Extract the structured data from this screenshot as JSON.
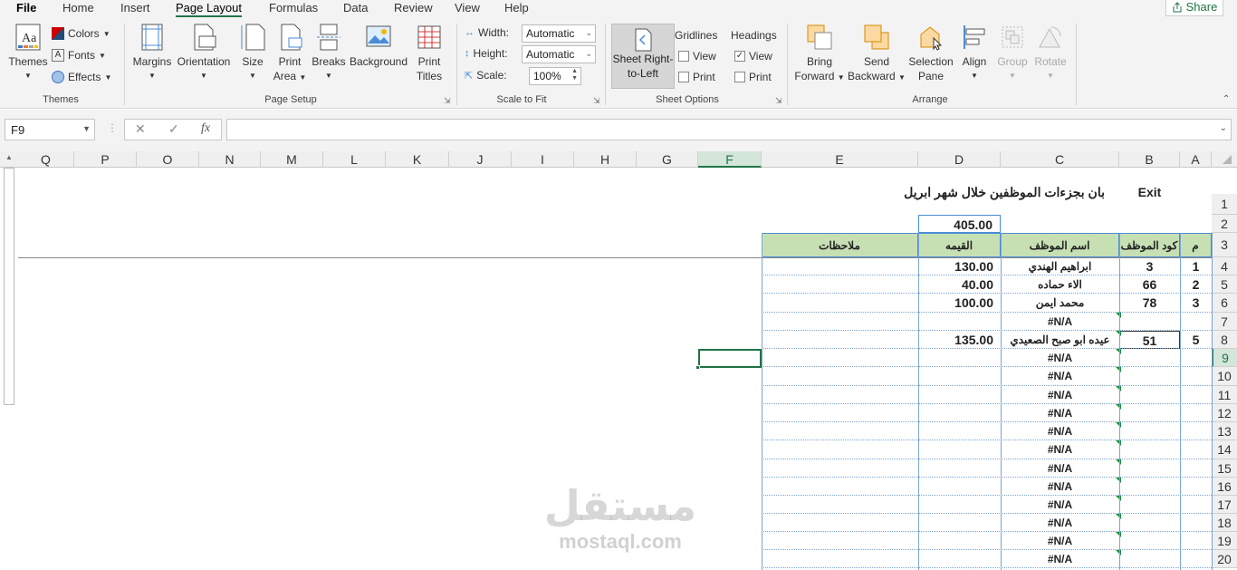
{
  "tabs": {
    "file": "File",
    "home": "Home",
    "insert": "Insert",
    "page_layout": "Page Layout",
    "formulas": "Formulas",
    "data": "Data",
    "review": "Review",
    "view": "View",
    "help": "Help",
    "share": "Share"
  },
  "ribbon": {
    "themes": {
      "themes": "Themes",
      "colors": "Colors",
      "fonts": "Fonts",
      "effects": "Effects",
      "group": "Themes"
    },
    "page_setup": {
      "margins": "Margins",
      "orientation": "Orientation",
      "size": "Size",
      "print_area_1": "Print",
      "print_area_2": "Area",
      "breaks": "Breaks",
      "background": "Background",
      "print_titles_1": "Print",
      "print_titles_2": "Titles",
      "group": "Page Setup"
    },
    "scale": {
      "width_label": "Width:",
      "width_value": "Automatic",
      "height_label": "Height:",
      "height_value": "Automatic",
      "scale_label": "Scale:",
      "scale_value": "100%",
      "group": "Scale to Fit"
    },
    "sheet_options": {
      "rtl_1": "Sheet Right-",
      "rtl_2": "to-Left",
      "gridlines": "Gridlines",
      "headings": "Headings",
      "view": "View",
      "print": "Print",
      "group": "Sheet Options"
    },
    "arrange": {
      "bring_1": "Bring",
      "bring_2": "Forward",
      "send_1": "Send",
      "send_2": "Backward",
      "sel_1": "Selection",
      "sel_2": "Pane",
      "align": "Align",
      "group_btn": "Group",
      "rotate": "Rotate",
      "group": "Arrange"
    }
  },
  "formula_bar": {
    "namebox": "F9",
    "fx": "fx",
    "formula": ""
  },
  "columns": [
    "Q",
    "P",
    "O",
    "N",
    "M",
    "L",
    "K",
    "J",
    "I",
    "H",
    "G",
    "F",
    "E",
    "D",
    "C",
    "B",
    "A"
  ],
  "rows": [
    "1",
    "2",
    "3",
    "4",
    "5",
    "6",
    "7",
    "8",
    "9",
    "10",
    "11",
    "12",
    "13",
    "14",
    "15",
    "16",
    "17",
    "18",
    "19",
    "20"
  ],
  "sheet": {
    "title": "بان بجزءات الموظفين خلال شهر ابريل",
    "exit": "Exit",
    "total": "405.00",
    "headers": {
      "no": "م",
      "code": "كود الموظف",
      "name": "اسم الموظف",
      "value": "القيمه",
      "notes": "ملاحظات"
    },
    "records": [
      {
        "no": "1",
        "code": "3",
        "name": "ابراهيم الهندي",
        "value": "130.00"
      },
      {
        "no": "2",
        "code": "66",
        "name": "الاء حماده",
        "value": "40.00"
      },
      {
        "no": "3",
        "code": "78",
        "name": "محمد ايمن",
        "value": "100.00"
      },
      {
        "no": "",
        "code": "",
        "name": "#N/A",
        "value": ""
      },
      {
        "no": "5",
        "code": "51",
        "name": "عيده ابو صبح الصعيدي",
        "value": "135.00"
      },
      {
        "no": "",
        "code": "",
        "name": "#N/A",
        "value": ""
      },
      {
        "no": "",
        "code": "",
        "name": "#N/A",
        "value": ""
      },
      {
        "no": "",
        "code": "",
        "name": "#N/A",
        "value": ""
      },
      {
        "no": "",
        "code": "",
        "name": "#N/A",
        "value": ""
      },
      {
        "no": "",
        "code": "",
        "name": "#N/A",
        "value": ""
      },
      {
        "no": "",
        "code": "",
        "name": "#N/A",
        "value": ""
      },
      {
        "no": "",
        "code": "",
        "name": "#N/A",
        "value": ""
      },
      {
        "no": "",
        "code": "",
        "name": "#N/A",
        "value": ""
      },
      {
        "no": "",
        "code": "",
        "name": "#N/A",
        "value": ""
      },
      {
        "no": "",
        "code": "",
        "name": "#N/A",
        "value": ""
      },
      {
        "no": "",
        "code": "",
        "name": "#N/A",
        "value": ""
      },
      {
        "no": "",
        "code": "",
        "name": "#N/A",
        "value": ""
      }
    ]
  },
  "watermark": {
    "ar": "مستقل",
    "en": "mostaql.com"
  },
  "colors": {
    "accent": "#217346",
    "header_fill": "#c6e0b4",
    "border": "#7aa6d6"
  }
}
